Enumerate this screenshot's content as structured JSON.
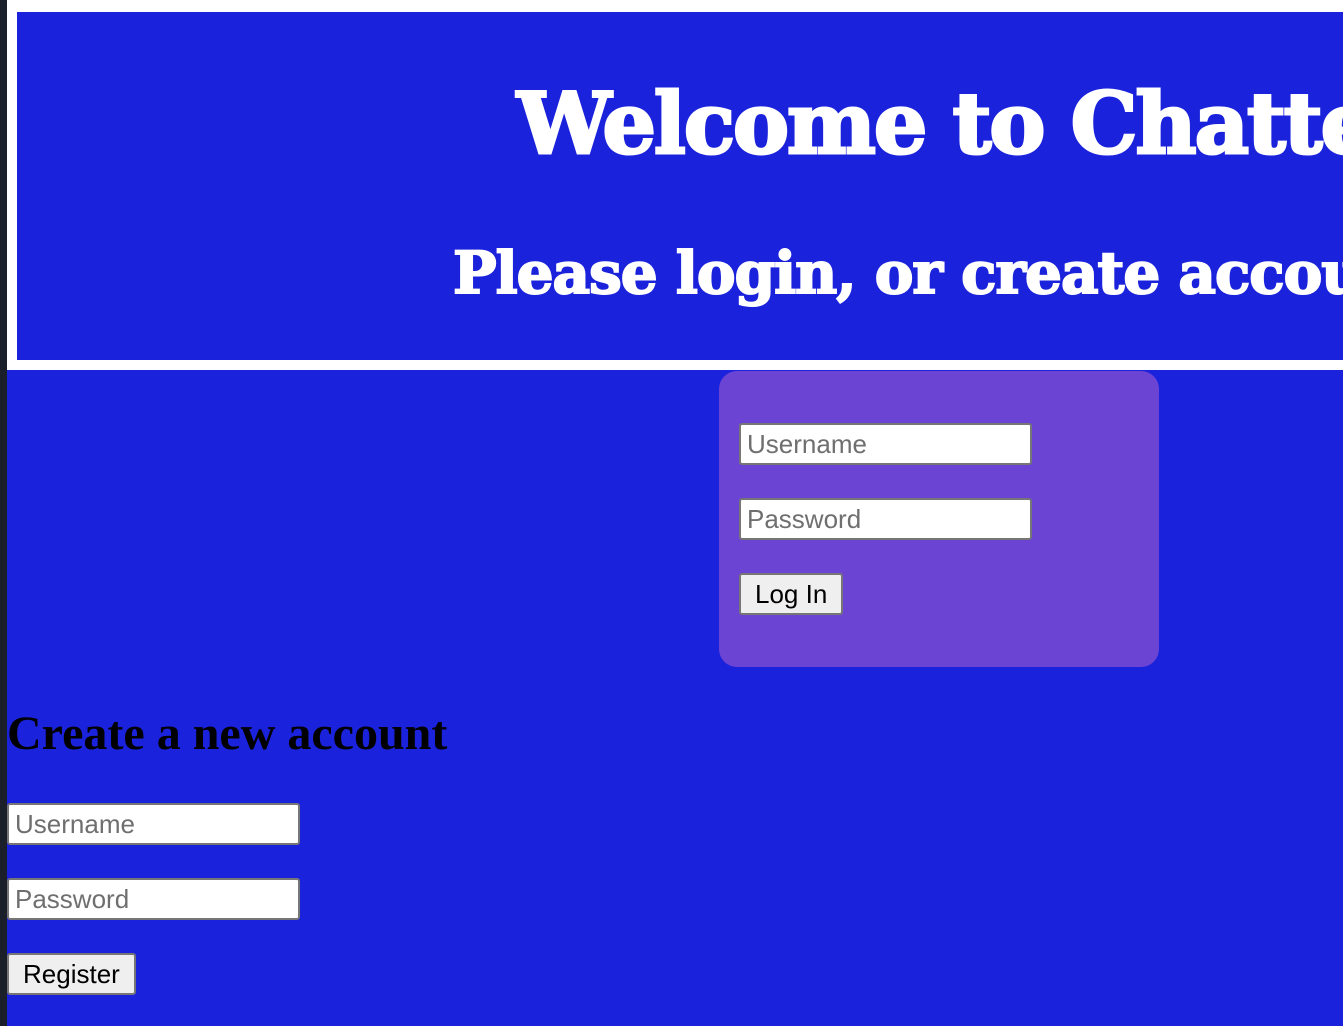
{
  "header": {
    "title": "Welcome to Chatter",
    "subtitle": "Please login, or create account"
  },
  "login": {
    "username_placeholder": "Username",
    "password_placeholder": "Password",
    "submit_label": "Log In"
  },
  "register": {
    "heading": "Create a new account",
    "username_placeholder": "Username",
    "password_placeholder": "Password",
    "submit_label": "Register"
  },
  "colors": {
    "background": "#1a22dc",
    "login_panel": "#6c44d4",
    "header_border": "#ffffff"
  }
}
